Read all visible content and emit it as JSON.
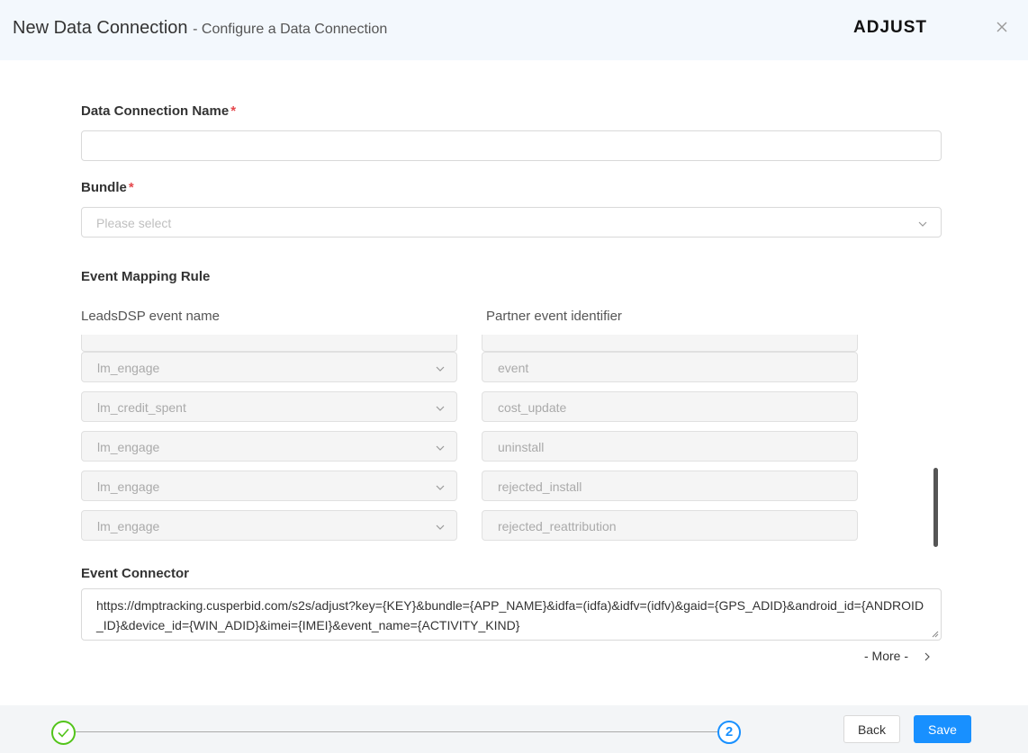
{
  "header": {
    "title": "New Data Connection",
    "subtitle": "- Configure a Data Connection",
    "logo_text": "ADJUST"
  },
  "form": {
    "name_label": "Data Connection Name",
    "name_value": "",
    "required_mark": "*",
    "bundle_label": "Bundle",
    "bundle_placeholder": "Please select"
  },
  "mapping": {
    "title": "Event Mapping Rule",
    "col_left": "LeadsDSP event name",
    "col_right": "Partner event identifier",
    "rows": [
      {
        "event_name": "lm_engage",
        "partner_id": "event"
      },
      {
        "event_name": "lm_credit_spent",
        "partner_id": "cost_update"
      },
      {
        "event_name": "lm_engage",
        "partner_id": "uninstall"
      },
      {
        "event_name": "lm_engage",
        "partner_id": "rejected_install"
      },
      {
        "event_name": "lm_engage",
        "partner_id": "rejected_reattribution"
      }
    ]
  },
  "connector": {
    "label": "Event Connector",
    "value": "https://dmptracking.cusperbid.com/s2s/adjust?key={KEY}&bundle={APP_NAME}&idfa=(idfa)&idfv=(idfv)&gaid={GPS_ADID}&android_id={ANDROID_ID}&device_id={WIN_ADID}&imei={IMEI}&event_name={ACTIVITY_KIND}",
    "more_label": "- More -"
  },
  "footer": {
    "step2_label": "2",
    "back_label": "Back",
    "save_label": "Save"
  },
  "colors": {
    "primary": "#1890ff",
    "success": "#52c41a",
    "required": "#e5484d",
    "header_bg": "#f3f8fd"
  }
}
